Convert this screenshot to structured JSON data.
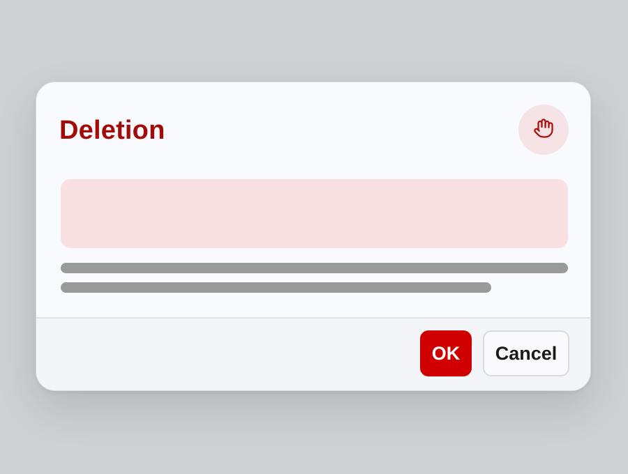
{
  "dialog": {
    "title": "Deletion",
    "header_icon": "raised-hand-icon",
    "buttons": {
      "ok_label": "OK",
      "cancel_label": "Cancel"
    }
  },
  "colors": {
    "accent": "#d00000",
    "title": "#a30b0b",
    "banner": "#f8e0e3",
    "placeholder_line": "#9a9a9a"
  }
}
